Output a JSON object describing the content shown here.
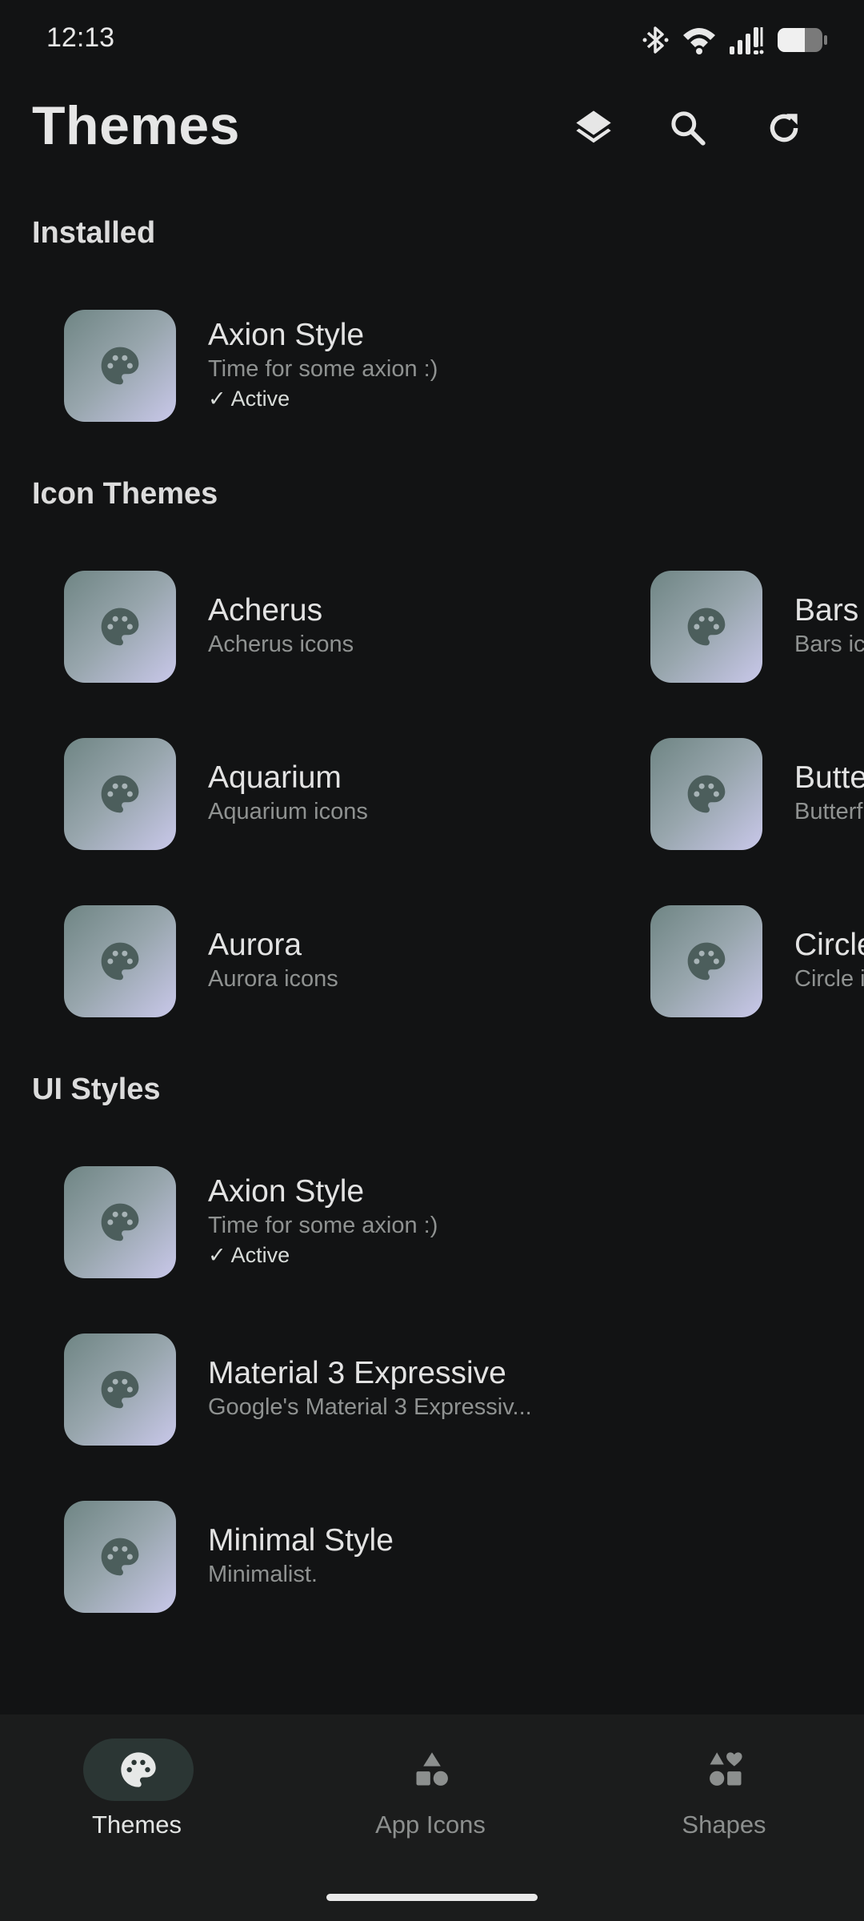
{
  "status_bar": {
    "time": "12:13"
  },
  "header": {
    "title": "Themes",
    "actions": [
      {
        "icon": "layers-icon"
      },
      {
        "icon": "search-icon"
      },
      {
        "icon": "refresh-icon"
      }
    ]
  },
  "sections": {
    "installed": {
      "title": "Installed",
      "items": [
        {
          "title": "Axion Style",
          "subtitle": "Time for some axion :)",
          "status": "✓ Active"
        }
      ]
    },
    "icon_themes": {
      "title": "Icon Themes",
      "items": [
        {
          "title": "Acherus",
          "subtitle": "Acherus icons"
        },
        {
          "title": "Bars",
          "subtitle": "Bars icons"
        },
        {
          "title": "Aquarium",
          "subtitle": "Aquarium icons"
        },
        {
          "title": "Butterfly",
          "subtitle": "Butterfly icons"
        },
        {
          "title": "Aurora",
          "subtitle": "Aurora icons"
        },
        {
          "title": "Circle",
          "subtitle": "Circle icons"
        }
      ]
    },
    "ui_styles": {
      "title": "UI Styles",
      "items": [
        {
          "title": "Axion Style",
          "subtitle": "Time for some axion :)",
          "status": "✓ Active"
        },
        {
          "title": "Material 3 Expressive",
          "subtitle": "Google's Material 3 Expressiv..."
        },
        {
          "title": "Minimal Style",
          "subtitle": "Minimalist."
        }
      ]
    }
  },
  "bottom_nav": {
    "items": [
      {
        "label": "Themes",
        "icon": "palette-icon",
        "active": true
      },
      {
        "label": "App Icons",
        "icon": "shapes-triangle-icon",
        "active": false
      },
      {
        "label": "Shapes",
        "icon": "shapes-heart-icon",
        "active": false
      }
    ]
  },
  "colors": {
    "background": "#121314",
    "thumb_gradient_start": "#6f8584",
    "thumb_gradient_end": "#c9c8ea",
    "palette_icon": "#4c5e5c",
    "active_nav_pill": "#2b3634"
  }
}
